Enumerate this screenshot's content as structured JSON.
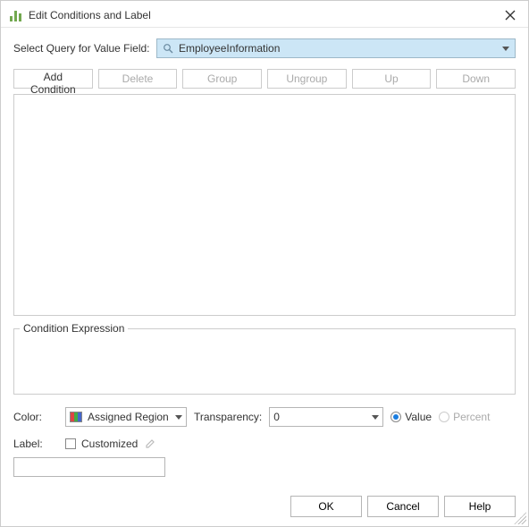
{
  "titlebar": {
    "title": "Edit Conditions and Label"
  },
  "query": {
    "label": "Select Query for Value Field:",
    "value": "EmployeeInformation"
  },
  "buttons": {
    "add_condition": "Add Condition",
    "delete": "Delete",
    "group": "Group",
    "ungroup": "Ungroup",
    "up": "Up",
    "down": "Down"
  },
  "condition_expression": {
    "legend": "Condition Expression"
  },
  "color": {
    "label": "Color:",
    "combo_value": "Assigned Region",
    "transparency_label": "Transparency:",
    "transparency_value": "0",
    "radio_value": "Value",
    "radio_percent": "Percent"
  },
  "label_section": {
    "label": "Label:",
    "customized": "Customized",
    "input_value": ""
  },
  "footer": {
    "ok": "OK",
    "cancel": "Cancel",
    "help": "Help"
  }
}
